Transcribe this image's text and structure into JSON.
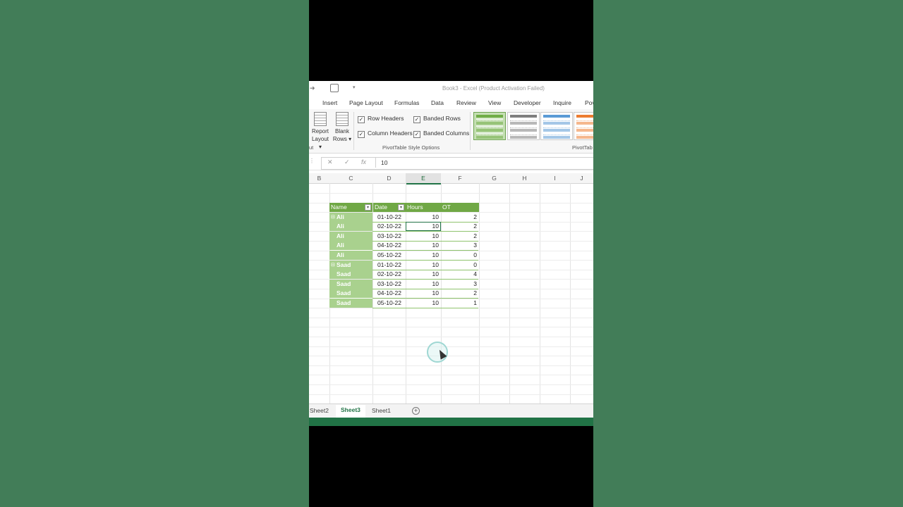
{
  "window": {
    "title": "Book3 - Excel (Product Activation Failed)"
  },
  "ribbon_tabs": [
    "Insert",
    "Page Layout",
    "Formulas",
    "Data",
    "Review",
    "View",
    "Developer",
    "Inquire",
    "Pov"
  ],
  "ribbon": {
    "report_layout": {
      "line1": "Report",
      "line2": "Layout ▾"
    },
    "blank_rows": {
      "line1": "Blank",
      "line2": "Rows ▾"
    },
    "left_group_fragment": "ut",
    "options": {
      "row_headers": "Row Headers",
      "column_headers": "Column Headers",
      "banded_rows": "Banded Rows",
      "banded_columns": "Banded Columns"
    },
    "style_options_label": "PivotTable Style Options",
    "styles_label": "PivotTab",
    "style_swatch_colors": [
      "#70ad47",
      "#7f7f7f",
      "#5b9bd5",
      "#ed7d31"
    ]
  },
  "formula_bar": {
    "value": "10",
    "fx": "fx"
  },
  "columns": [
    "B",
    "C",
    "D",
    "E",
    "F",
    "G",
    "H",
    "I",
    "J"
  ],
  "active_column": "E",
  "table": {
    "headers": [
      "Name",
      "Date",
      "Hours",
      "OT"
    ],
    "rows": [
      {
        "name": "Ali",
        "date": "01-10-22",
        "hours": "10",
        "ot": "2",
        "group_start": true
      },
      {
        "name": "Ali",
        "date": "02-10-22",
        "hours": "10",
        "ot": "2",
        "group_start": false
      },
      {
        "name": "Ali",
        "date": "03-10-22",
        "hours": "10",
        "ot": "2",
        "group_start": false
      },
      {
        "name": "Ali",
        "date": "04-10-22",
        "hours": "10",
        "ot": "3",
        "group_start": false
      },
      {
        "name": "Ali",
        "date": "05-10-22",
        "hours": "10",
        "ot": "0",
        "group_start": false
      },
      {
        "name": "Saad",
        "date": "01-10-22",
        "hours": "10",
        "ot": "0",
        "group_start": true
      },
      {
        "name": "Saad",
        "date": "02-10-22",
        "hours": "10",
        "ot": "4",
        "group_start": false
      },
      {
        "name": "Saad",
        "date": "03-10-22",
        "hours": "10",
        "ot": "3",
        "group_start": false
      },
      {
        "name": "Saad",
        "date": "04-10-22",
        "hours": "10",
        "ot": "2",
        "group_start": false
      },
      {
        "name": "Saad",
        "date": "05-10-22",
        "hours": "10",
        "ot": "1",
        "group_start": false
      }
    ]
  },
  "sheets": [
    "Sheet2",
    "Sheet3",
    "Sheet1"
  ],
  "active_sheet": "Sheet3",
  "colors": {
    "accent": "#217346",
    "header_fill": "#70a845",
    "name_fill": "#a9d18e",
    "page_bg": "#427d58"
  }
}
